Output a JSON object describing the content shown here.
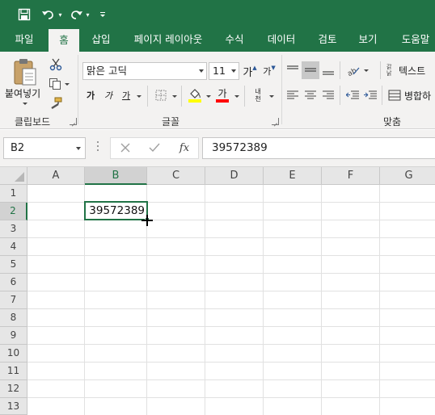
{
  "colors": {
    "brand": "#217346",
    "ribbon_bg": "#f3f2f1",
    "grid_line": "#e1e1e1"
  },
  "qat": {
    "save_icon": "save-icon",
    "undo_icon": "undo-icon",
    "redo_icon": "redo-icon",
    "customize_icon": "customize-qat-icon"
  },
  "tabs": [
    {
      "label": "파일"
    },
    {
      "label": "홈"
    },
    {
      "label": "삽입"
    },
    {
      "label": "페이지 레이아웃"
    },
    {
      "label": "수식"
    },
    {
      "label": "데이터"
    },
    {
      "label": "검토"
    },
    {
      "label": "보기"
    },
    {
      "label": "도움말"
    }
  ],
  "ribbon": {
    "clipboard": {
      "paste_label": "붙여넣기",
      "group_label": "클립보드"
    },
    "font": {
      "name": "맑은 고딕",
      "size": "11",
      "grow": "가",
      "shrink": "가",
      "bold": "가",
      "italic": "가",
      "underline": "가",
      "font_color": "가",
      "phonetic": "내천",
      "group_label": "글꼴"
    },
    "alignment": {
      "wrap_text": "텍스트",
      "merge": "병합하",
      "wrap_prefix": "갉낡",
      "group_label": "맞춤"
    }
  },
  "formula_bar": {
    "name_box": "B2",
    "content": "39572389",
    "fx_label": "fx"
  },
  "sheet": {
    "columns": [
      "A",
      "B",
      "C",
      "D",
      "E",
      "F",
      "G"
    ],
    "rows": [
      "1",
      "2",
      "3",
      "4",
      "5",
      "6",
      "7",
      "8",
      "9",
      "10",
      "11",
      "12",
      "13"
    ],
    "selected_cell": "B2",
    "cells": {
      "B2": "39572389"
    }
  }
}
